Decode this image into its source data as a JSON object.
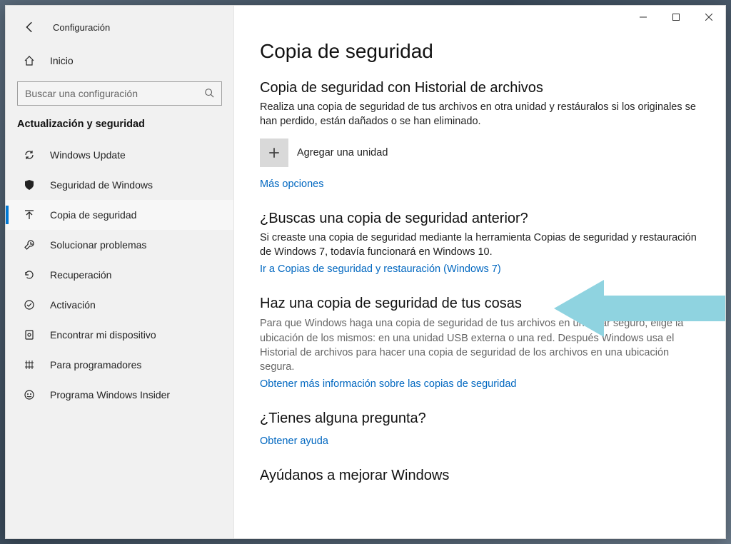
{
  "window": {
    "app_title": "Configuración"
  },
  "sidebar": {
    "home_label": "Inicio",
    "search_placeholder": "Buscar una configuración",
    "group_title": "Actualización y seguridad",
    "items": [
      {
        "label": "Windows Update"
      },
      {
        "label": "Seguridad de Windows"
      },
      {
        "label": "Copia de seguridad"
      },
      {
        "label": "Solucionar problemas"
      },
      {
        "label": "Recuperación"
      },
      {
        "label": "Activación"
      },
      {
        "label": "Encontrar mi dispositivo"
      },
      {
        "label": "Para programadores"
      },
      {
        "label": "Programa Windows Insider"
      }
    ]
  },
  "content": {
    "page_title": "Copia de seguridad",
    "s1": {
      "heading": "Copia de seguridad con Historial de archivos",
      "desc": "Realiza una copia de seguridad de tus archivos en otra unidad y restáuralos si los originales se han perdido, están dañados o se han eliminado.",
      "add_label": "Agregar una unidad",
      "more_options": "Más opciones"
    },
    "s2": {
      "heading": "¿Buscas una copia de seguridad anterior?",
      "desc": "Si creaste una copia de seguridad mediante la herramienta Copias de seguridad y restauración de Windows 7, todavía funcionará en Windows 10.",
      "link": "Ir a Copias de seguridad y restauración (Windows 7)"
    },
    "s3": {
      "heading": "Haz una copia de seguridad de tus cosas",
      "desc": "Para que Windows haga una copia de seguridad de tus archivos en un lugar seguro, elige la ubicación de los mismos: en una unidad USB externa o una red. Después Windows usa el Historial de archivos para hacer una copia de seguridad de los archivos en una ubicación segura.",
      "link": "Obtener más información sobre las copias de seguridad"
    },
    "s4": {
      "heading": "¿Tienes alguna pregunta?",
      "link": "Obtener ayuda"
    },
    "s5": {
      "heading": "Ayúdanos a mejorar Windows"
    }
  },
  "colors": {
    "accent": "#0078d4",
    "link": "#0067c0",
    "arrow": "#8fd3e0"
  }
}
